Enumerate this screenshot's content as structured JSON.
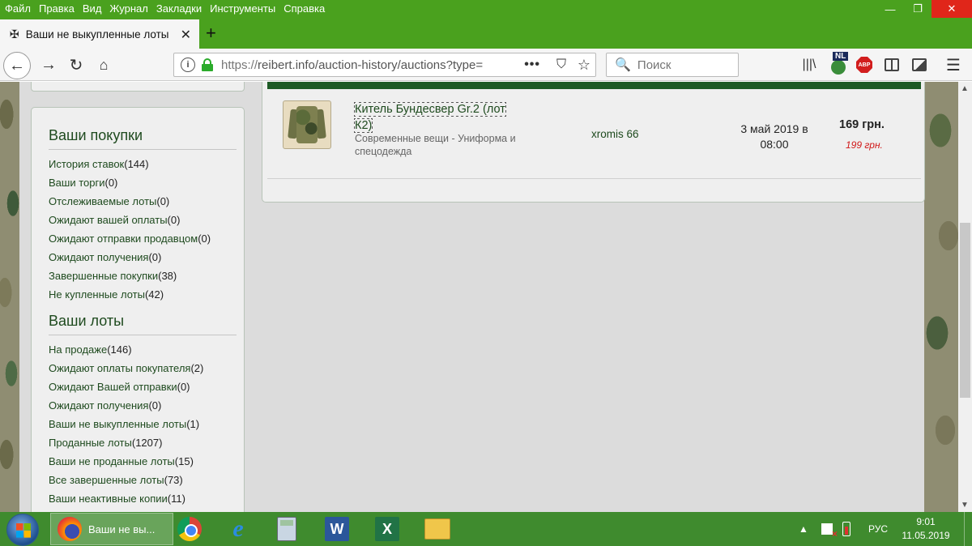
{
  "menubar": {
    "items": [
      "Файл",
      "Правка",
      "Вид",
      "Журнал",
      "Закладки",
      "Инструменты",
      "Справка"
    ]
  },
  "window": {
    "minimize": "—",
    "maximize": "❐",
    "close": "✕"
  },
  "tab": {
    "favicon": "✠",
    "title": "Ваши не выкупленные лоты | ",
    "close": "✕",
    "new_tab": "+"
  },
  "nav": {
    "back": "←",
    "forward": "→",
    "reload": "↻",
    "home": "⌂"
  },
  "urlbar": {
    "scheme": "https://",
    "url": "reibert.info/auction-history/auctions?type=",
    "more": "•••",
    "pocket": "⛉",
    "star": "☆"
  },
  "search": {
    "icon": "🔍",
    "placeholder": "Поиск"
  },
  "toolbar": {
    "library": "|||\\",
    "nl_badge": "NL",
    "abp": "ABP",
    "menu": "☰"
  },
  "sidebar": {
    "purchases_title": "Ваши покупки",
    "purchases": [
      {
        "label": "История ставок",
        "count": "(144)"
      },
      {
        "label": "Ваши торги",
        "count": "(0)"
      },
      {
        "label": "Отслеживаемые лоты",
        "count": "(0)"
      },
      {
        "label": "Ожидают вашей оплаты",
        "count": "(0)"
      },
      {
        "label": "Ожидают отправки продавцом",
        "count": "(0)"
      },
      {
        "label": "Ожидают получения",
        "count": "(0)"
      },
      {
        "label": "Завершенные покупки",
        "count": "(38)"
      },
      {
        "label": "Не купленные лоты",
        "count": "(42)"
      }
    ],
    "lots_title": "Ваши лоты",
    "lots": [
      {
        "label": "На продаже",
        "count": "(146)"
      },
      {
        "label": "Ожидают оплаты покупателя",
        "count": "(2)"
      },
      {
        "label": "Ожидают Вашей отправки",
        "count": "(0)"
      },
      {
        "label": "Ожидают получения",
        "count": "(0)"
      },
      {
        "label": "Ваши не выкупленные лоты",
        "count": "(1)"
      },
      {
        "label": "Проданные лоты",
        "count": "(1207)"
      },
      {
        "label": "Ваши не проданные лоты",
        "count": "(15)"
      },
      {
        "label": "Все завершенные лоты",
        "count": "(73)"
      },
      {
        "label": "Ваши неактивные копии",
        "count": "(11)"
      }
    ]
  },
  "lot": {
    "title": "Китель Бундесвер Gr.2 (лот К2)",
    "category": "Современные вещи - Униформа и спецодежда",
    "seller": "xromis 66",
    "date": "3 май 2019 в 08:00",
    "price": "169 грн.",
    "old_price": "199 грн."
  },
  "taskbar": {
    "firefox_label": "Ваши не вы...",
    "ie": "e",
    "word": "W",
    "excel": "X",
    "tray_arrow": "▲",
    "lang": "РУС",
    "time": "9:01",
    "date": "11.05.2019"
  },
  "scrollbar": {
    "up": "▲",
    "down": "▼"
  }
}
